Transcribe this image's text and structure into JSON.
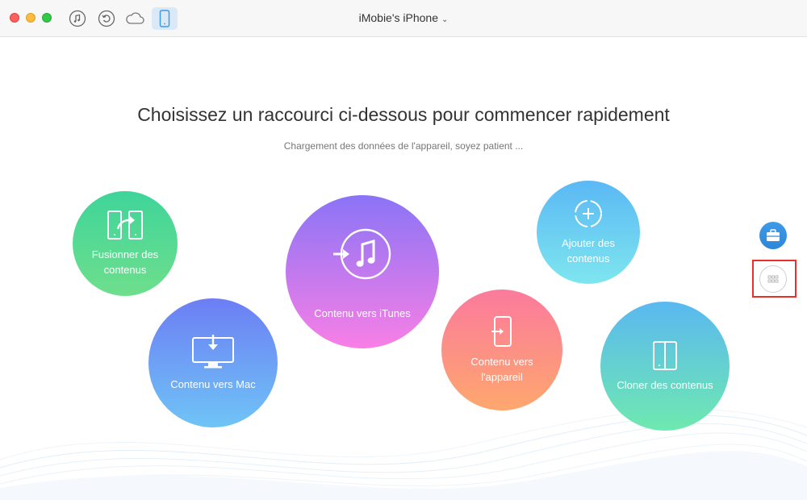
{
  "window": {
    "device_name": "iMobie's iPhone"
  },
  "toolbar": {
    "items": [
      {
        "icon": "music-note-icon"
      },
      {
        "icon": "restore-icon"
      },
      {
        "icon": "cloud-icon"
      },
      {
        "icon": "phone-icon",
        "active": true
      }
    ]
  },
  "main": {
    "headline": "Choisissez un raccourci ci-dessous pour commencer rapidement",
    "status": "Chargement des données de l'appareil, soyez patient ...",
    "shortcuts": {
      "merge": {
        "label": "Fusionner des contenus",
        "icon": "merge-icon"
      },
      "to_mac": {
        "label": "Contenu vers Mac",
        "icon": "monitor-download-icon"
      },
      "to_itunes": {
        "label": "Contenu vers iTunes",
        "icon": "itunes-icon"
      },
      "to_device": {
        "label": "Contenu vers l'appareil",
        "icon": "phone-import-icon"
      },
      "add": {
        "label": "Ajouter des contenus",
        "icon": "add-circle-icon"
      },
      "clone": {
        "label": "Cloner des contenus",
        "icon": "clone-icon"
      }
    }
  },
  "side_actions": {
    "toolbox_icon": "toolbox-icon",
    "more_icon": "grid-dots-icon"
  },
  "colors": {
    "accent": "#3d9be8",
    "highlight": "#e8312a"
  }
}
